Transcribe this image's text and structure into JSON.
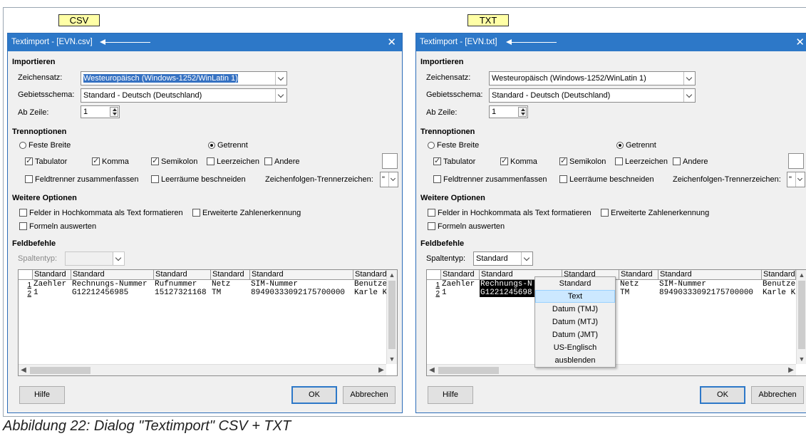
{
  "labels": {
    "left": "CSV",
    "right": "TXT"
  },
  "caption": "Abbildung 22: Dialog \"Textimport\" CSV + TXT",
  "dialogs": {
    "csv": {
      "title": "Textimport - [EVN.csv]",
      "importieren": "Importieren",
      "zeichensatz_label": "Zeichensatz:",
      "zeichensatz_value": "Westeuropäisch (Windows-1252/WinLatin 1)",
      "gebiet_label": "Gebietsschema:",
      "gebiet_value": "Standard - Deutsch (Deutschland)",
      "abzeile_label": "Ab Zeile:",
      "abzeile_value": "1",
      "trenn": "Trennoptionen",
      "feste": "Feste Breite",
      "getrennt": "Getrennt",
      "tab": "Tabulator",
      "komma": "Komma",
      "semi": "Semikolon",
      "leer": "Leerzeichen",
      "andere": "Andere",
      "feldtrenner": "Feldtrenner zusammenfassen",
      "leerraeume": "Leerräume beschneiden",
      "zeichenfolgen": "Zeichenfolgen-Trennerzeichen:",
      "quote": "\"",
      "weitere": "Weitere Optionen",
      "hochkomma": "Felder in Hochkommata als Text formatieren",
      "zahlen": "Erweiterte Zahlenerkennung",
      "formeln": "Formeln auswerten",
      "feldbefehle": "Feldbefehle",
      "spaltentyp_label": "Spaltentyp:",
      "spaltentyp_value": "",
      "headers": [
        "Standard",
        "Standard",
        "Standard",
        "Standard",
        "Standard",
        "Standard"
      ],
      "rows": [
        [
          "Zaehler",
          "Rechnungs-Nummer",
          "Rufnummer",
          "Netz",
          "SIM-Nummer",
          "Benutzer"
        ],
        [
          "1",
          "G12212456985",
          "15127321168",
          "TM",
          "89490333092175700000",
          "Karle Ku"
        ]
      ],
      "rownums": [
        "1",
        "2"
      ],
      "hilfe": "Hilfe",
      "ok": "OK",
      "abbrechen": "Abbrechen"
    },
    "txt": {
      "title": "Textimport - [EVN.txt]",
      "importieren": "Importieren",
      "zeichensatz_label": "Zeichensatz:",
      "zeichensatz_value": "Westeuropäisch (Windows-1252/WinLatin 1)",
      "gebiet_label": "Gebietsschema:",
      "gebiet_value": "Standard - Deutsch (Deutschland)",
      "abzeile_label": "Ab Zeile:",
      "abzeile_value": "1",
      "trenn": "Trennoptionen",
      "feste": "Feste Breite",
      "getrennt": "Getrennt",
      "tab": "Tabulator",
      "komma": "Komma",
      "semi": "Semikolon",
      "leer": "Leerzeichen",
      "andere": "Andere",
      "feldtrenner": "Feldtrenner zusammenfassen",
      "leerraeume": "Leerräume beschneiden",
      "zeichenfolgen": "Zeichenfolgen-Trennerzeichen:",
      "quote": "\"",
      "weitere": "Weitere Optionen",
      "hochkomma": "Felder in Hochkommata als Text formatieren",
      "zahlen": "Erweiterte Zahlenerkennung",
      "formeln": "Formeln auswerten",
      "feldbefehle": "Feldbefehle",
      "spaltentyp_label": "Spaltentyp:",
      "spaltentyp_value": "Standard",
      "headers": [
        "Standard",
        "Standard",
        "Standard",
        "Standard",
        "Standard",
        "Standard"
      ],
      "rows": [
        [
          "Zaehler",
          "Rechnungs-N",
          "",
          "Netz",
          "SIM-Nummer",
          "Benutzer"
        ],
        [
          "1",
          "G1221245698",
          "",
          "TM",
          "89490333092175700000",
          "Karle Ku"
        ]
      ],
      "rownums": [
        "1",
        "2"
      ],
      "hilfe": "Hilfe",
      "ok": "OK",
      "abbrechen": "Abbrechen",
      "menu": [
        "Standard",
        "Text",
        "Datum (TMJ)",
        "Datum (MTJ)",
        "Datum (JMT)",
        "US-Englisch",
        "ausblenden"
      ],
      "menu_selected": "Text"
    }
  },
  "colors": {
    "titlebar": "#2d78c8",
    "label_bg": "#ffffa6",
    "selection": "#3571c2",
    "menu_highlight": "#cce8ff"
  }
}
